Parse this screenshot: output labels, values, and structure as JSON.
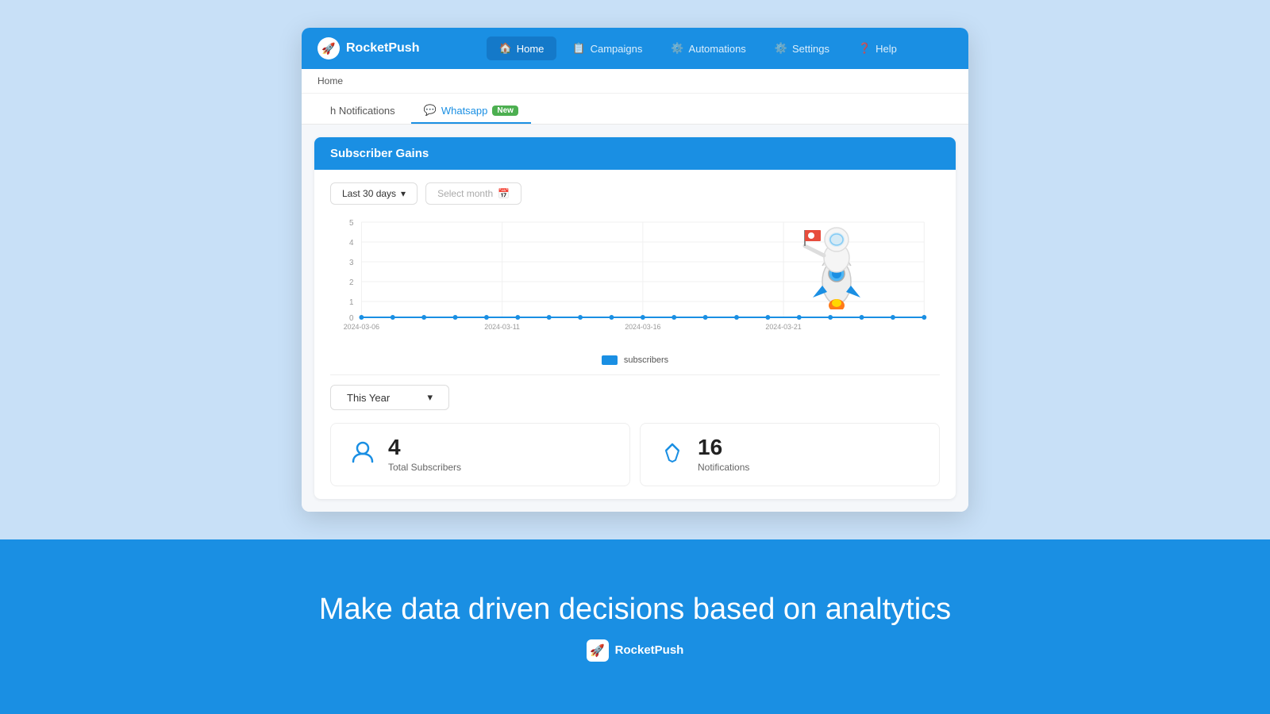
{
  "brand": {
    "name": "RocketPush",
    "icon": "🚀"
  },
  "navbar": {
    "items": [
      {
        "label": "Home",
        "icon": "🏠",
        "active": true
      },
      {
        "label": "Campaigns",
        "icon": "📋",
        "active": false
      },
      {
        "label": "Automations",
        "icon": "⚙️",
        "active": false
      },
      {
        "label": "Settings",
        "icon": "⚙️",
        "active": false
      },
      {
        "label": "Help",
        "icon": "❓",
        "active": false
      }
    ]
  },
  "breadcrumb": "Home",
  "subtabs": [
    {
      "label": "h Notifications",
      "icon": "",
      "active": false
    },
    {
      "label": "Whatsapp",
      "icon": "💬",
      "active": true,
      "badge": "New"
    }
  ],
  "card": {
    "title": "Subscriber Gains",
    "dropdown_label": "Last 30 days",
    "select_month_placeholder": "Select month"
  },
  "chart": {
    "y_labels": [
      "5",
      "4",
      "3",
      "2",
      "1",
      "0"
    ],
    "x_labels": [
      "2024-03-06",
      "2024-03-11",
      "2024-03-16",
      "2024-03-21"
    ],
    "legend": "subscribers",
    "color": "#1a8fe3"
  },
  "year_filter": {
    "label": "This Year"
  },
  "stats": [
    {
      "icon": "person",
      "value": "4",
      "label": "Total Subscribers"
    },
    {
      "icon": "cursor",
      "value": "16",
      "label": "Notifications"
    }
  ],
  "footer": {
    "tagline": "Make data driven decisions based on analtytics",
    "brand_name": "RocketPush"
  }
}
